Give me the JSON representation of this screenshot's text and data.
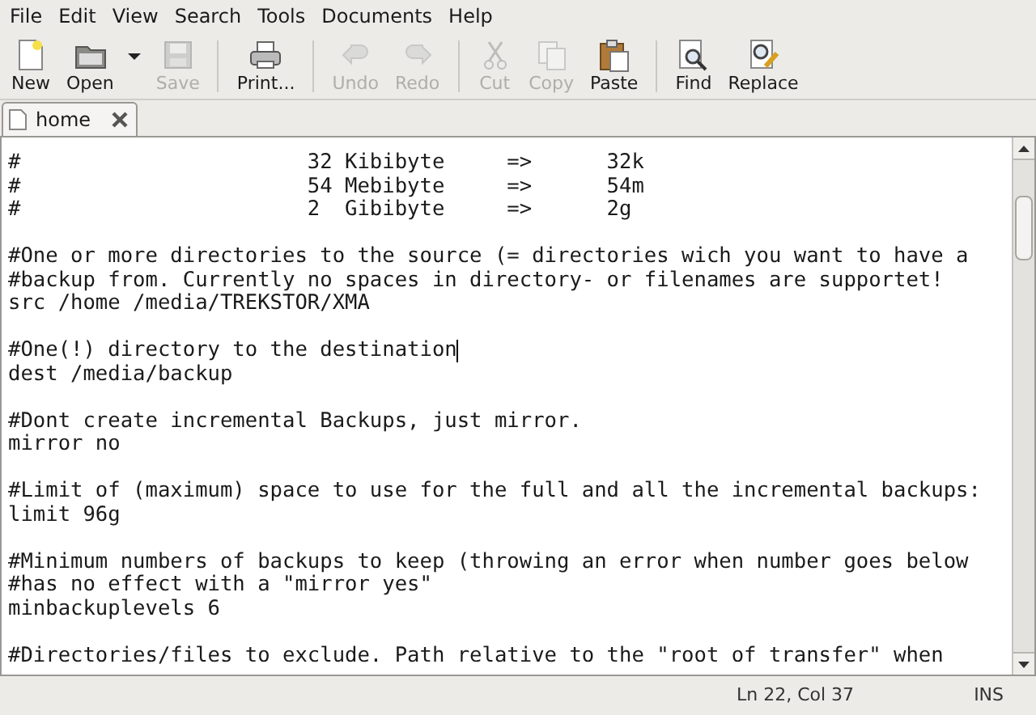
{
  "menu": [
    "File",
    "Edit",
    "View",
    "Search",
    "Tools",
    "Documents",
    "Help"
  ],
  "toolbar_groups": [
    [
      {
        "kind": "new",
        "label": "New",
        "disabled": false,
        "dropdown": false
      },
      {
        "kind": "open",
        "label": "Open",
        "disabled": false,
        "dropdown": true
      },
      {
        "kind": "save",
        "label": "Save",
        "disabled": true,
        "dropdown": false
      }
    ],
    [
      {
        "kind": "print",
        "label": "Print...",
        "disabled": false,
        "dropdown": false
      }
    ],
    [
      {
        "kind": "undo",
        "label": "Undo",
        "disabled": true,
        "dropdown": false
      },
      {
        "kind": "redo",
        "label": "Redo",
        "disabled": true,
        "dropdown": false
      }
    ],
    [
      {
        "kind": "cut",
        "label": "Cut",
        "disabled": true,
        "dropdown": false
      },
      {
        "kind": "copy",
        "label": "Copy",
        "disabled": true,
        "dropdown": false
      },
      {
        "kind": "paste",
        "label": "Paste",
        "disabled": false,
        "dropdown": false
      }
    ],
    [
      {
        "kind": "find",
        "label": "Find",
        "disabled": false,
        "dropdown": false
      },
      {
        "kind": "replace",
        "label": "Replace",
        "disabled": false,
        "dropdown": false
      }
    ]
  ],
  "tabs": [
    {
      "label": "home",
      "selected": true
    }
  ],
  "editor_lines": [
    {
      "kind": "text",
      "text": "#                       32 Kibibyte     =>      32k",
      "cursor": false
    },
    {
      "kind": "text",
      "text": "#                       54 Mebibyte     =>      54m",
      "cursor": false
    },
    {
      "kind": "text",
      "text": "#                       2  Gibibyte     =>      2g",
      "cursor": false
    },
    {
      "kind": "blank",
      "cursor": false
    },
    {
      "kind": "text",
      "text": "#One or more directories to the source (= directories wich you want to have a",
      "cursor": false
    },
    {
      "kind": "text",
      "text": "#backup from. Currently no spaces in directory- or filenames are supportet!",
      "cursor": false
    },
    {
      "kind": "text",
      "text": "src /home /media/TREKSTOR/XMA",
      "cursor": false
    },
    {
      "kind": "blank",
      "cursor": false
    },
    {
      "kind": "text",
      "text": "#One(!) directory to the destination",
      "cursor": true
    },
    {
      "kind": "text",
      "text": "dest /media/backup",
      "cursor": false
    },
    {
      "kind": "blank",
      "cursor": false
    },
    {
      "kind": "text",
      "text": "#Dont create incremental Backups, just mirror.",
      "cursor": false
    },
    {
      "kind": "text",
      "text": "mirror no",
      "cursor": false
    },
    {
      "kind": "blank",
      "cursor": false
    },
    {
      "kind": "text",
      "text": "#Limit of (maximum) space to use for the full and all the incremental backups:",
      "cursor": false
    },
    {
      "kind": "text",
      "text": "limit 96g",
      "cursor": false
    },
    {
      "kind": "blank",
      "cursor": false
    },
    {
      "kind": "text",
      "text": "#Minimum numbers of backups to keep (throwing an error when number goes below",
      "cursor": false
    },
    {
      "kind": "text",
      "text": "#has no effect with a \"mirror yes\"",
      "cursor": false
    },
    {
      "kind": "text",
      "text": "minbackuplevels 6",
      "cursor": false
    },
    {
      "kind": "blank",
      "cursor": false
    },
    {
      "kind": "text",
      "text": "#Directories/files to exclude. Path relative to the \"root of transfer\" when",
      "cursor": false
    }
  ],
  "status_bar": {
    "position": "Ln 22, Col 37",
    "mode": "INS"
  }
}
